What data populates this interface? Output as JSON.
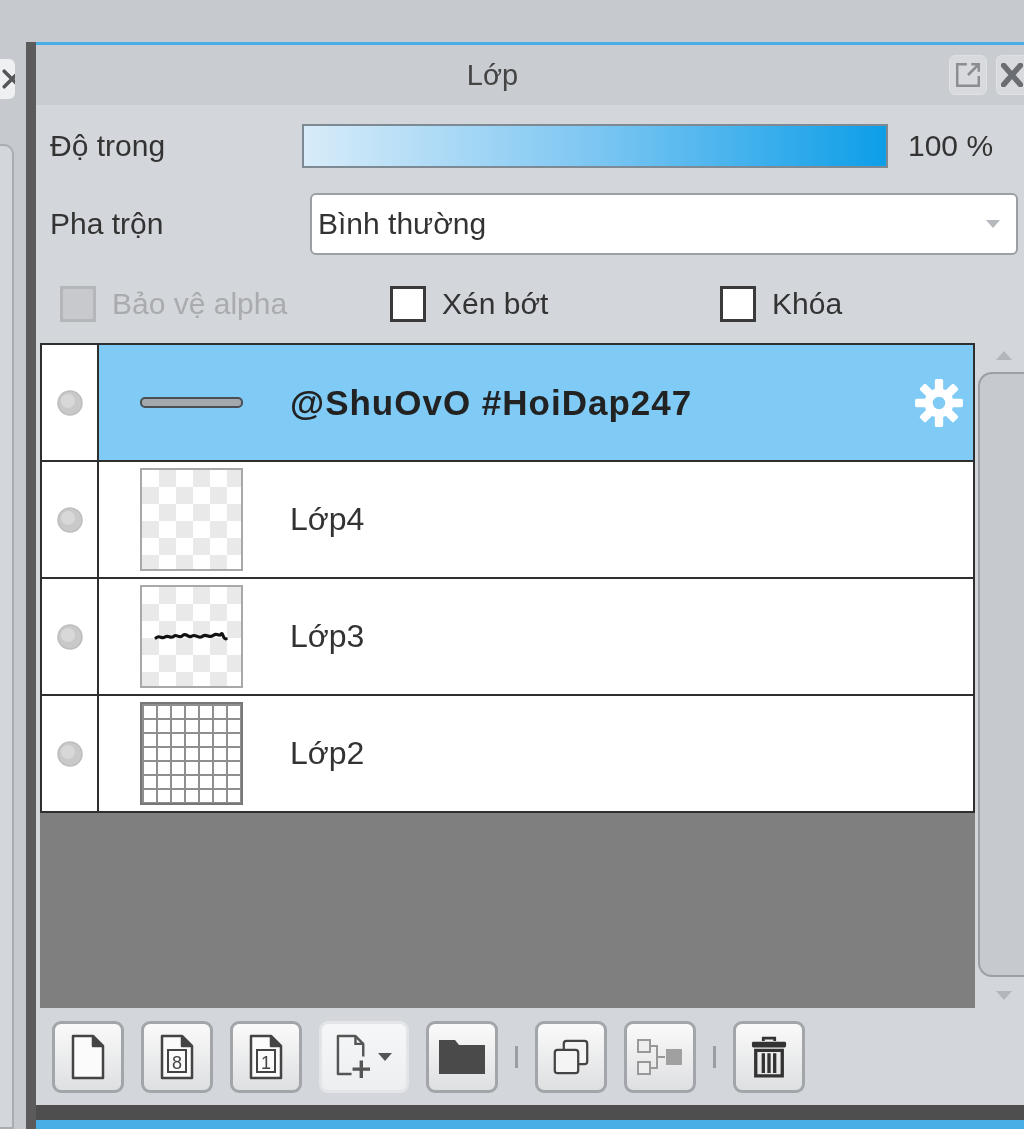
{
  "panel": {
    "title": "Lớp"
  },
  "opacity": {
    "label": "Độ trong",
    "level": 1,
    "reading": "100 %"
  },
  "blend": {
    "label": "Pha trộn",
    "value": "Bình thường"
  },
  "options": [
    {
      "label": "Bảo vệ alpha",
      "checked": false,
      "disabled": true
    },
    {
      "label": "Xén bớt",
      "checked": false,
      "disabled": false
    },
    {
      "label": "Khóa",
      "checked": false,
      "disabled": false
    }
  ],
  "layers": [
    {
      "name": "@ShuOvO #HoiDap247",
      "selected": true,
      "kind": "strip"
    },
    {
      "name": "Lớp4",
      "selected": false,
      "kind": "blank"
    },
    {
      "name": "Lớp3",
      "selected": false,
      "kind": "scribble"
    },
    {
      "name": "Lớp2",
      "selected": false,
      "kind": "grid"
    }
  ],
  "toolbar": [
    {
      "kind": "new-page"
    },
    {
      "kind": "numbered-page",
      "glyph": "8"
    },
    {
      "kind": "numbered-page",
      "glyph": "1"
    },
    {
      "kind": "add-page-menu"
    },
    {
      "kind": "folder"
    },
    {
      "kind": "separator"
    },
    {
      "kind": "duplicate"
    },
    {
      "kind": "merge"
    },
    {
      "kind": "separator"
    },
    {
      "kind": "trash"
    }
  ]
}
